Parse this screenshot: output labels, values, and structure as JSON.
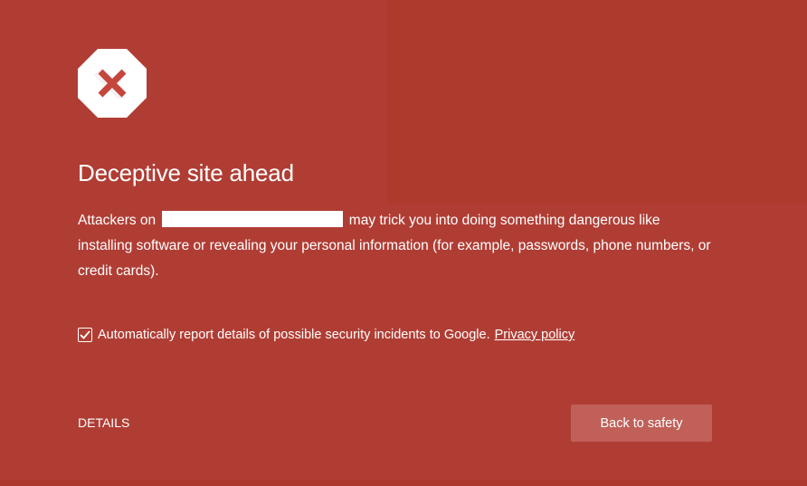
{
  "page": {
    "background_color": "#b03d34",
    "accent_panel_color": "#ad3a2c"
  },
  "icon": {
    "name": "danger-octagon-x-icon",
    "fill": "#ffffff",
    "mark_color": "#c4463d"
  },
  "title": "Deceptive site ahead",
  "body": {
    "before_site": "Attackers on",
    "site_redacted": "",
    "after_site": "may trick you into doing something dangerous like installing software or revealing your personal information (for example, passwords, phone numbers, or credit cards)."
  },
  "report": {
    "checked": true,
    "label": "Automatically report details of possible security incidents to Google.",
    "privacy_link": "Privacy policy"
  },
  "actions": {
    "details_label": "DETAILS",
    "back_label": "Back to safety",
    "back_button_color": "#c06059"
  }
}
